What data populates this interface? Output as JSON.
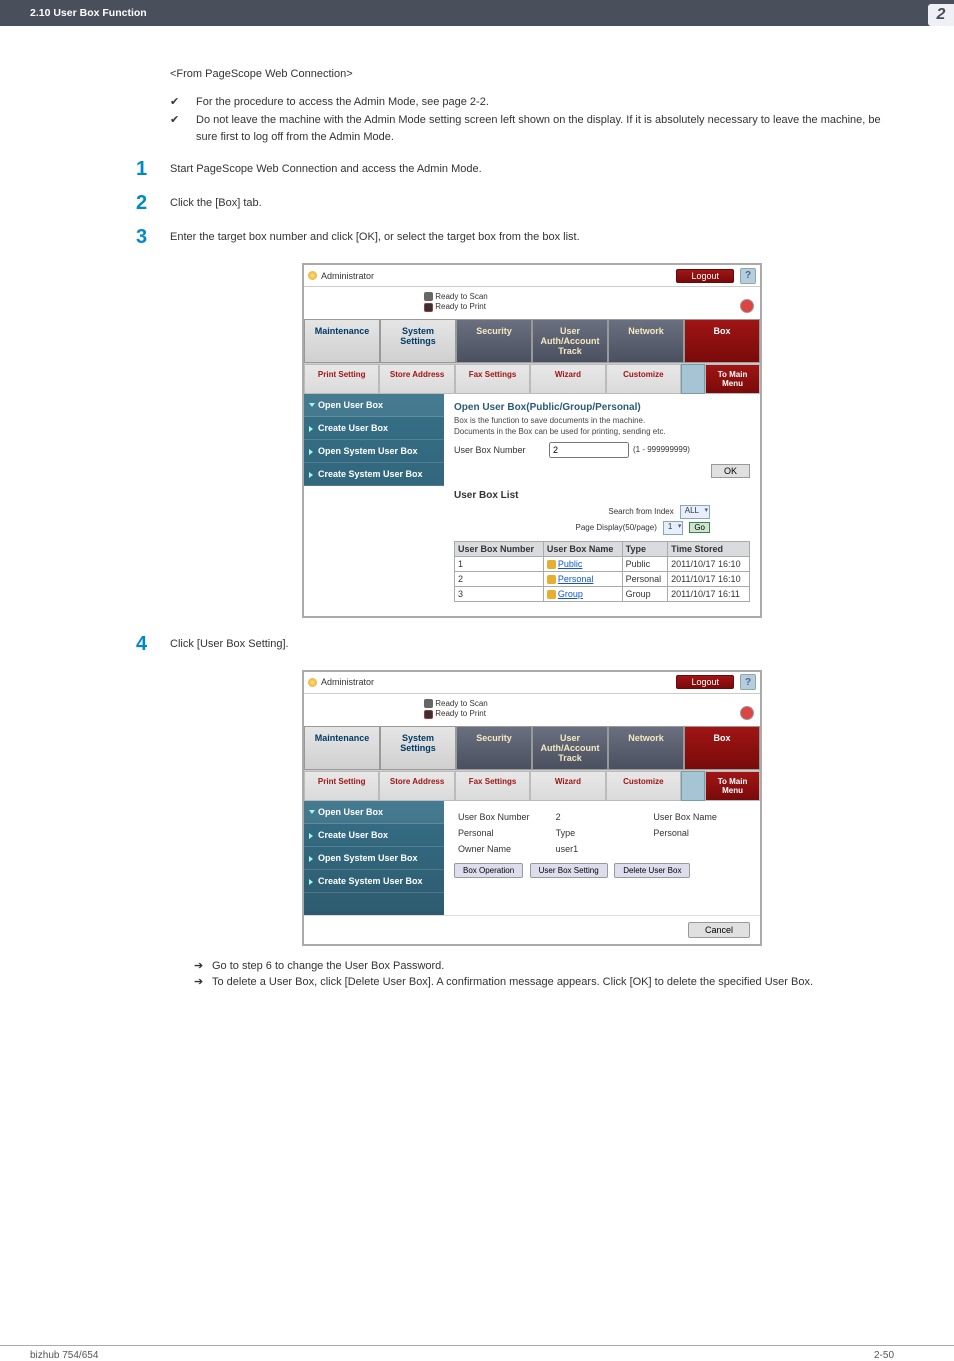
{
  "topbar": {
    "section": "2.10    User Box Function",
    "badge": "2"
  },
  "intro_lead": "<From PageScope Web Connection>",
  "checks": [
    "For the procedure to access the Admin Mode, see page 2-2.",
    "Do not leave the machine with the Admin Mode setting screen left shown on the display. If it is absolutely necessary to leave the machine, be sure first to log off from the Admin Mode."
  ],
  "steps": {
    "s1": "Start PageScope Web Connection and access the Admin Mode.",
    "s2": "Click the [Box] tab.",
    "s3": "Enter the target box number and click [OK], or select the target box from the box list.",
    "s4": "Click [User Box Setting]."
  },
  "sub_bullets": [
    "Go to step 6 to change the User Box Password.",
    "To delete a User Box, click [Delete User Box]. A confirmation message appears. Click [OK] to delete the specified User Box."
  ],
  "fig_common": {
    "admin": "Administrator",
    "ready_scan": "Ready to Scan",
    "ready_print": "Ready to Print",
    "logout": "Logout",
    "help": "?"
  },
  "main_tabs": [
    "Maintenance",
    "System Settings",
    "Security",
    "User Auth/Account Track",
    "Network",
    "Box"
  ],
  "sub_tabs": [
    "Print Setting",
    "Store Address",
    "Fax Settings",
    "Wizard",
    "Customize",
    "To Main Menu"
  ],
  "side_menu": [
    "Open User Box",
    "Create User Box",
    "Open System User Box",
    "Create System User Box"
  ],
  "fig1": {
    "title": "Open User Box(Public/Group/Personal)",
    "desc1": "Box is the function to save documents in the machine.",
    "desc2": "Documents in the Box can be used for printing, sending etc.",
    "ub_num_label": "User Box Number",
    "ub_num_val": "2",
    "ub_range": "(1 - 999999999)",
    "ok": "OK",
    "list_title": "User Box List",
    "search_lab": "Search from Index",
    "search_val": "ALL",
    "page_lab": "Page Display(50/page)",
    "page_val": "1",
    "go": "Go",
    "th": [
      "User Box Number",
      "User Box Name",
      "Type",
      "Time Stored"
    ],
    "rows": [
      {
        "num": "1",
        "name": "Public",
        "type": "Public",
        "time": "2011/10/17 16:10"
      },
      {
        "num": "2",
        "name": "Personal",
        "type": "Personal",
        "time": "2011/10/17 16:10"
      },
      {
        "num": "3",
        "name": "Group",
        "type": "Group",
        "time": "2011/10/17 16:11"
      }
    ]
  },
  "fig2": {
    "details": {
      "ubnum_l": "User Box Number",
      "ubnum_v": "2",
      "ubname_l": "User Box Name",
      "ubname_v": "Personal",
      "type_l": "Type",
      "type_v": "Personal",
      "owner_l": "Owner Name",
      "owner_v": "user1"
    },
    "ops": {
      "box_op": "Box Operation",
      "ub_set": "User Box Setting",
      "del": "Delete User Box"
    },
    "cancel": "Cancel"
  },
  "footer": {
    "left": "bizhub 754/654",
    "right": "2-50"
  }
}
